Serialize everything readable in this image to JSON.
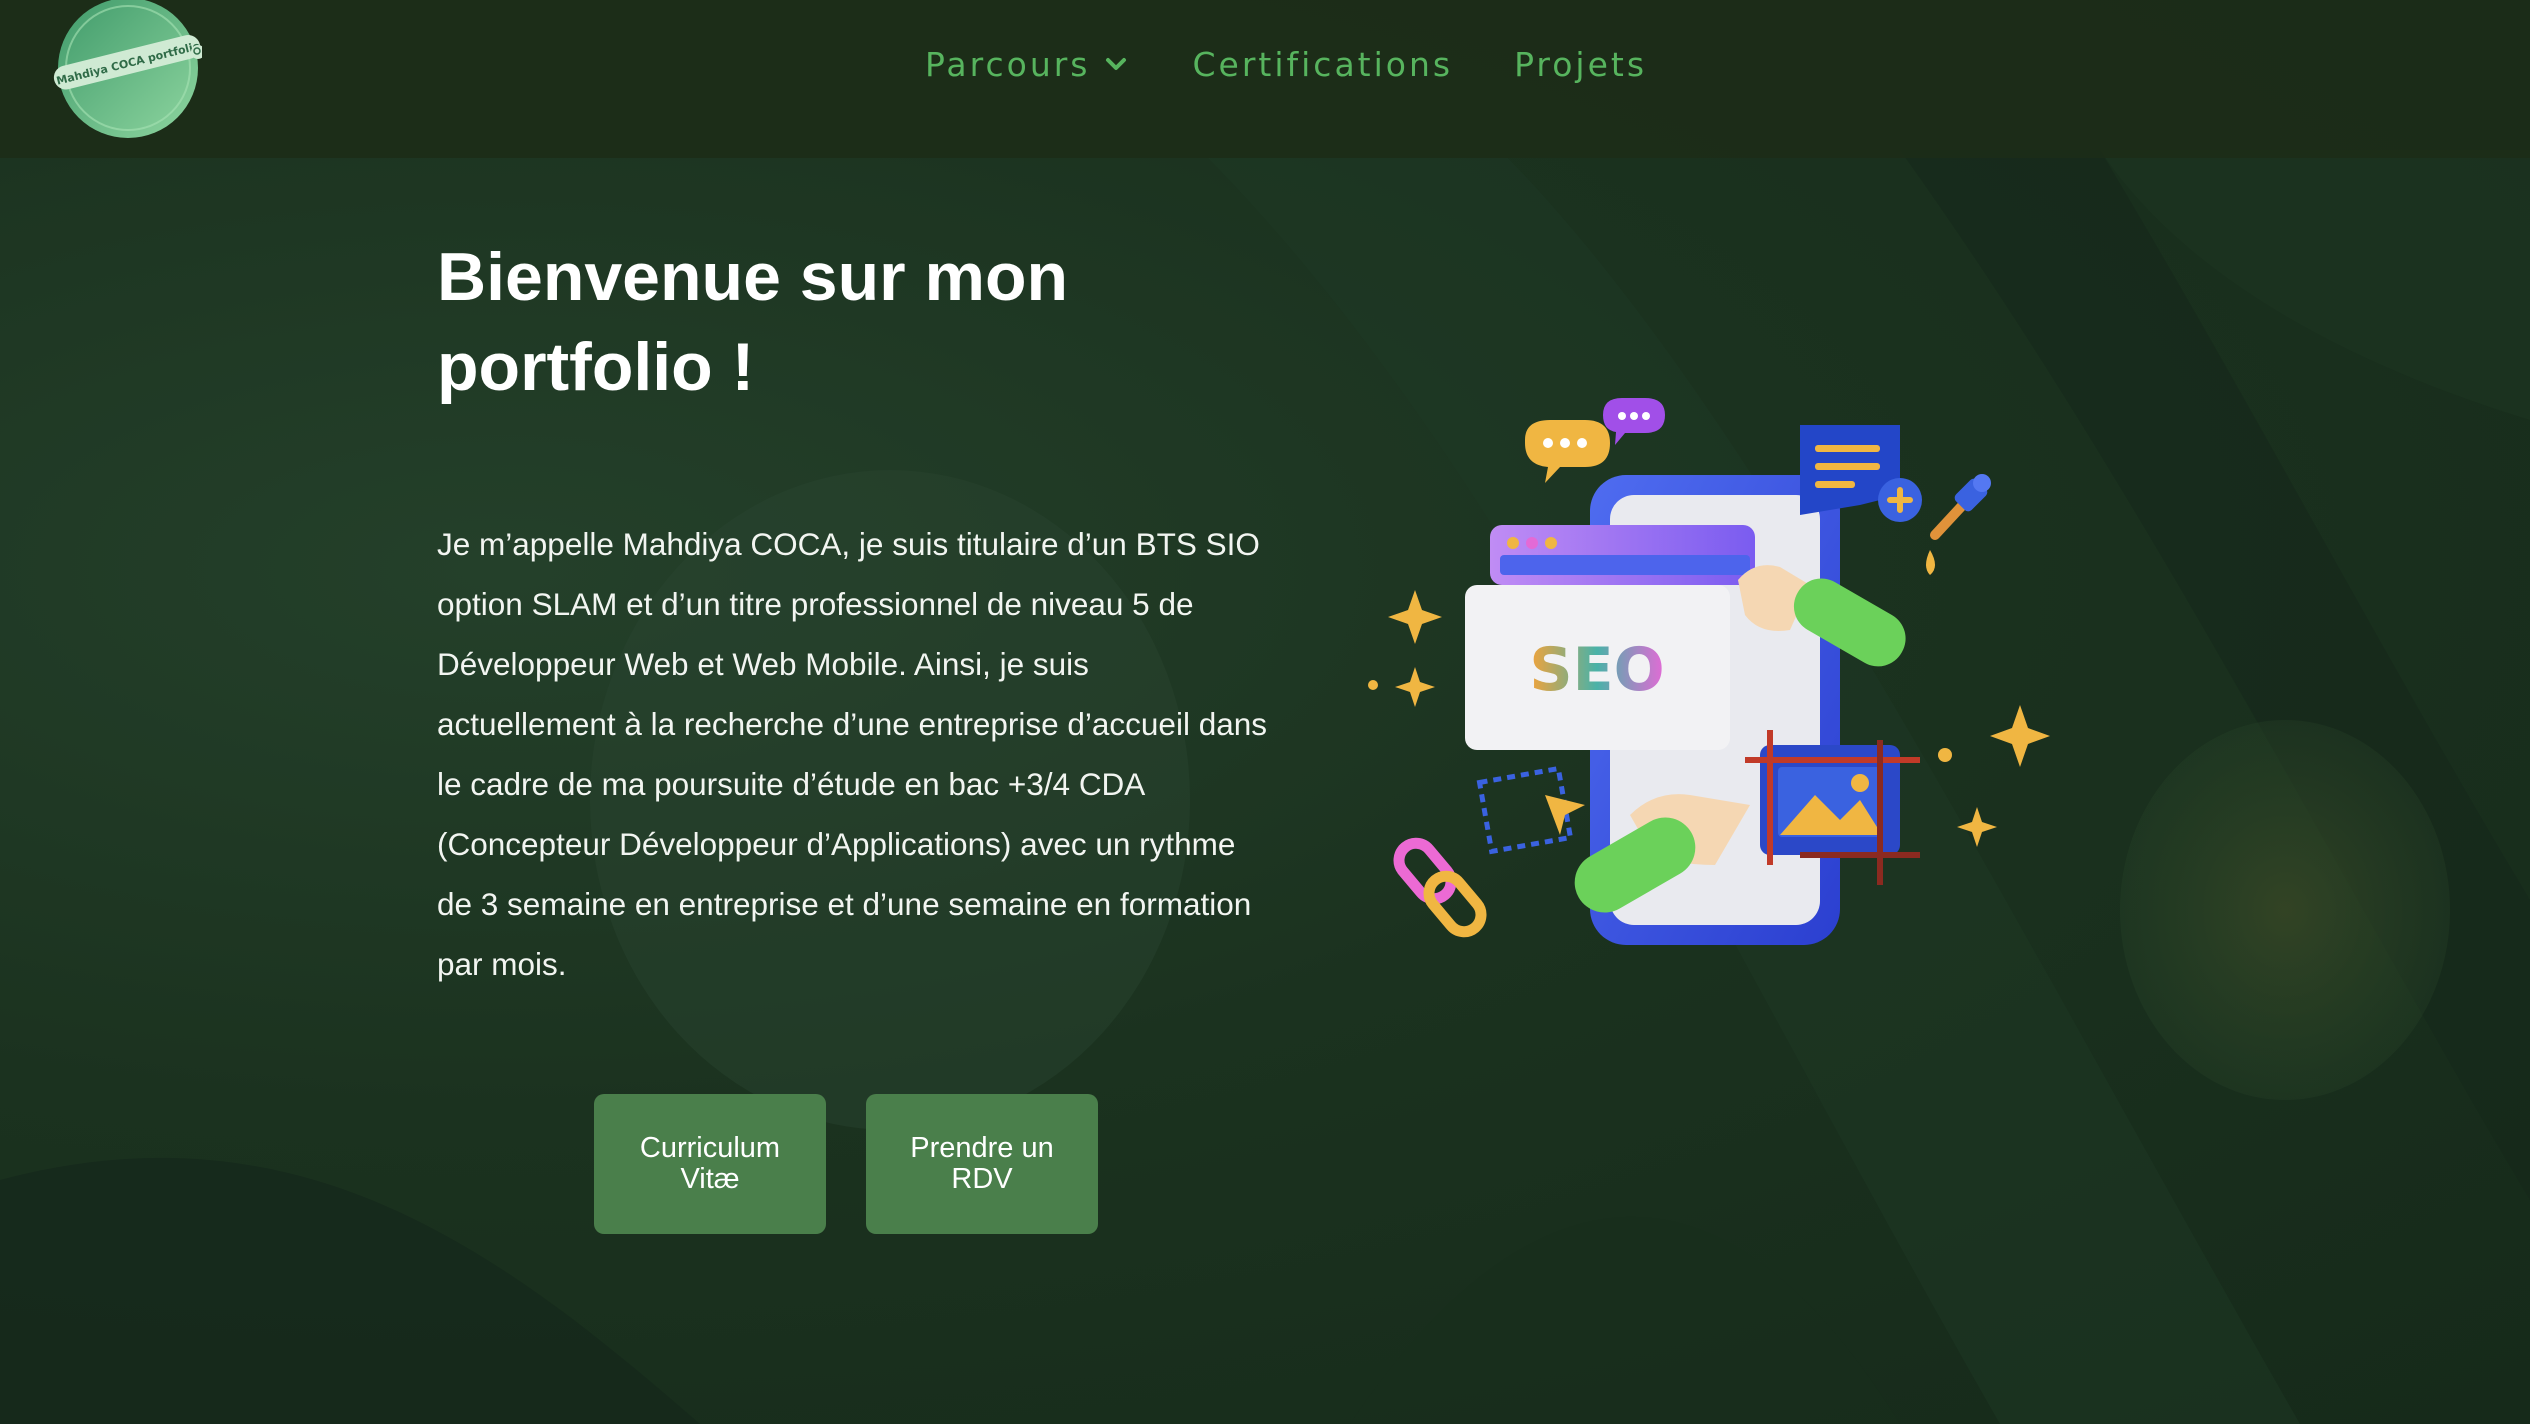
{
  "logo": {
    "text": "Mahdiya COCA portfolio"
  },
  "nav": {
    "items": [
      {
        "label": "Parcours",
        "has_dropdown": true
      },
      {
        "label": "Certifications"
      },
      {
        "label": "Projets"
      }
    ]
  },
  "hero": {
    "title_line1": "Bienvenue sur mon",
    "title_line2": "portfolio !",
    "paragraph": "Je m’appelle Mahdiya COCA,  je suis titulaire d’un BTS SIO option SLAM et d’un titre professionnel de niveau 5 de Développeur Web et Web Mobile. Ainsi, je suis actuellement à la recherche d’une entreprise d’accueil dans le cadre de ma poursuite d’étude en bac +3/4 CDA (Concepteur Développeur d’Applications) avec un rythme de 3 semaine en entreprise et d’une semaine en formation par mois.",
    "buttons": {
      "cv_label": "Curriculum Vitæ",
      "rdv_label": "Prendre un RDV"
    }
  },
  "illustration": {
    "seo_text": "SEO",
    "icons": [
      "chat-bubble-icon",
      "document-icon",
      "pipette-icon",
      "link-chain-icon",
      "image-icon",
      "sparkle-icon"
    ]
  },
  "colors": {
    "background": "#1c3220",
    "header": "#1c2c18",
    "nav_link": "#57b45e",
    "button": "#4a7f4b",
    "text": "#ffffff"
  }
}
